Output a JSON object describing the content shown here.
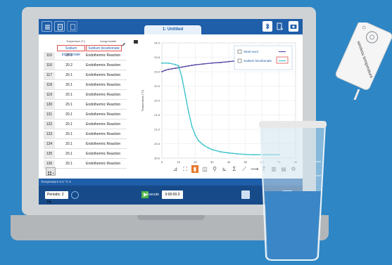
{
  "window": {
    "tab_title": "1: Untitled",
    "colors": {
      "brand_blue": "#1f5ea8",
      "background": "#2e86c4",
      "series_purple": "#5b4aa8",
      "series_cyan": "#3fc4cc"
    }
  },
  "toolbar_icons": [
    "menu-icon",
    "new-file-icon",
    "open-file-icon",
    "bluetooth-icon",
    "device-icon",
    "camera-icon"
  ],
  "table": {
    "col_headers": [
      "Temperature (°C)",
      "energy transfer"
    ],
    "set_labels": [
      "Sodium bicarbonate",
      "Sodium bicarbonate"
    ],
    "rows": [
      {
        "n": "115",
        "temp": "20.1",
        "energy": "Endothermic Reaction"
      },
      {
        "n": "116",
        "temp": "20.2",
        "energy": "Endothermic Reaction"
      },
      {
        "n": "117",
        "temp": "20.1",
        "energy": "Endothermic Reaction"
      },
      {
        "n": "118",
        "temp": "20.1",
        "energy": "Endothermic Reaction"
      },
      {
        "n": "119",
        "temp": "20.1",
        "energy": "Endothermic Reaction"
      },
      {
        "n": "120",
        "temp": "20.1",
        "energy": "Endothermic Reaction"
      },
      {
        "n": "121",
        "temp": "20.1",
        "energy": "Endothermic Reaction"
      },
      {
        "n": "122",
        "temp": "20.1",
        "energy": "Endothermic Reaction"
      },
      {
        "n": "123",
        "temp": "20.1",
        "energy": "Endothermic Reaction"
      },
      {
        "n": "124",
        "temp": "20.1",
        "energy": "Endothermic Reaction"
      },
      {
        "n": "125",
        "temp": "20.1",
        "energy": "Endothermic Reaction"
      },
      {
        "n": "126",
        "temp": "20.1",
        "energy": "Endothermic Reaction"
      }
    ]
  },
  "chart_data": {
    "type": "line",
    "title": "",
    "xlabel": "",
    "ylabel": "Temperature (°C)",
    "xlim": [
      0,
      80
    ],
    "ylim": [
      20.0,
      24.0
    ],
    "x_ticks": [
      "0",
      "10",
      "20",
      "30",
      "40",
      "50",
      "60",
      "70",
      "80"
    ],
    "y_ticks": [
      "24.0",
      "23.5",
      "23.0",
      "22.5",
      "22.0",
      "21.5",
      "21.0",
      "20.5",
      "20.0"
    ],
    "grid": true,
    "legend": "top-right",
    "series": [
      {
        "name": "Steel wool",
        "color": "#5b4aa8",
        "x": [
          0,
          2,
          4,
          6,
          8,
          10,
          12,
          14,
          16,
          18,
          20,
          25,
          30,
          35,
          40,
          45,
          50,
          55,
          60,
          65,
          70
        ],
        "y": [
          23.0,
          23.05,
          23.08,
          23.1,
          23.12,
          23.14,
          23.16,
          23.18,
          23.2,
          23.22,
          23.24,
          23.27,
          23.3,
          23.32,
          23.35,
          23.38,
          23.42,
          23.47,
          23.51,
          23.55,
          23.58
        ]
      },
      {
        "name": "Sodium bicarbonate",
        "color": "#3fc4cc",
        "x": [
          0,
          4,
          8,
          10,
          12,
          14,
          16,
          18,
          20,
          22,
          25,
          28,
          30,
          35,
          40,
          45,
          50,
          55,
          60,
          65,
          70
        ],
        "y": [
          23.3,
          23.3,
          23.25,
          23.2,
          22.8,
          22.2,
          21.6,
          21.1,
          20.8,
          20.6,
          20.45,
          20.35,
          20.3,
          20.22,
          20.18,
          20.15,
          20.13,
          20.12,
          20.12,
          20.12,
          20.12
        ]
      }
    ]
  },
  "chart_tools": [
    "chart-type-icon",
    "autoscale-icon",
    "select-icon",
    "zoom-icon",
    "annotation-icon",
    "line-fit-icon",
    "sum-icon",
    "tangent-icon",
    "curve-fit-icon",
    "text-icon",
    "bar-icon",
    "stats-icon",
    "more-icon"
  ],
  "status": {
    "text": "Temperature 0.0 °C ▾"
  },
  "bottom": {
    "period_label": "Periodic: 2 Hz",
    "execute_label": "Execute",
    "time_value": "0:00:00.0"
  },
  "sensor": {
    "label": "wireless temperature"
  }
}
